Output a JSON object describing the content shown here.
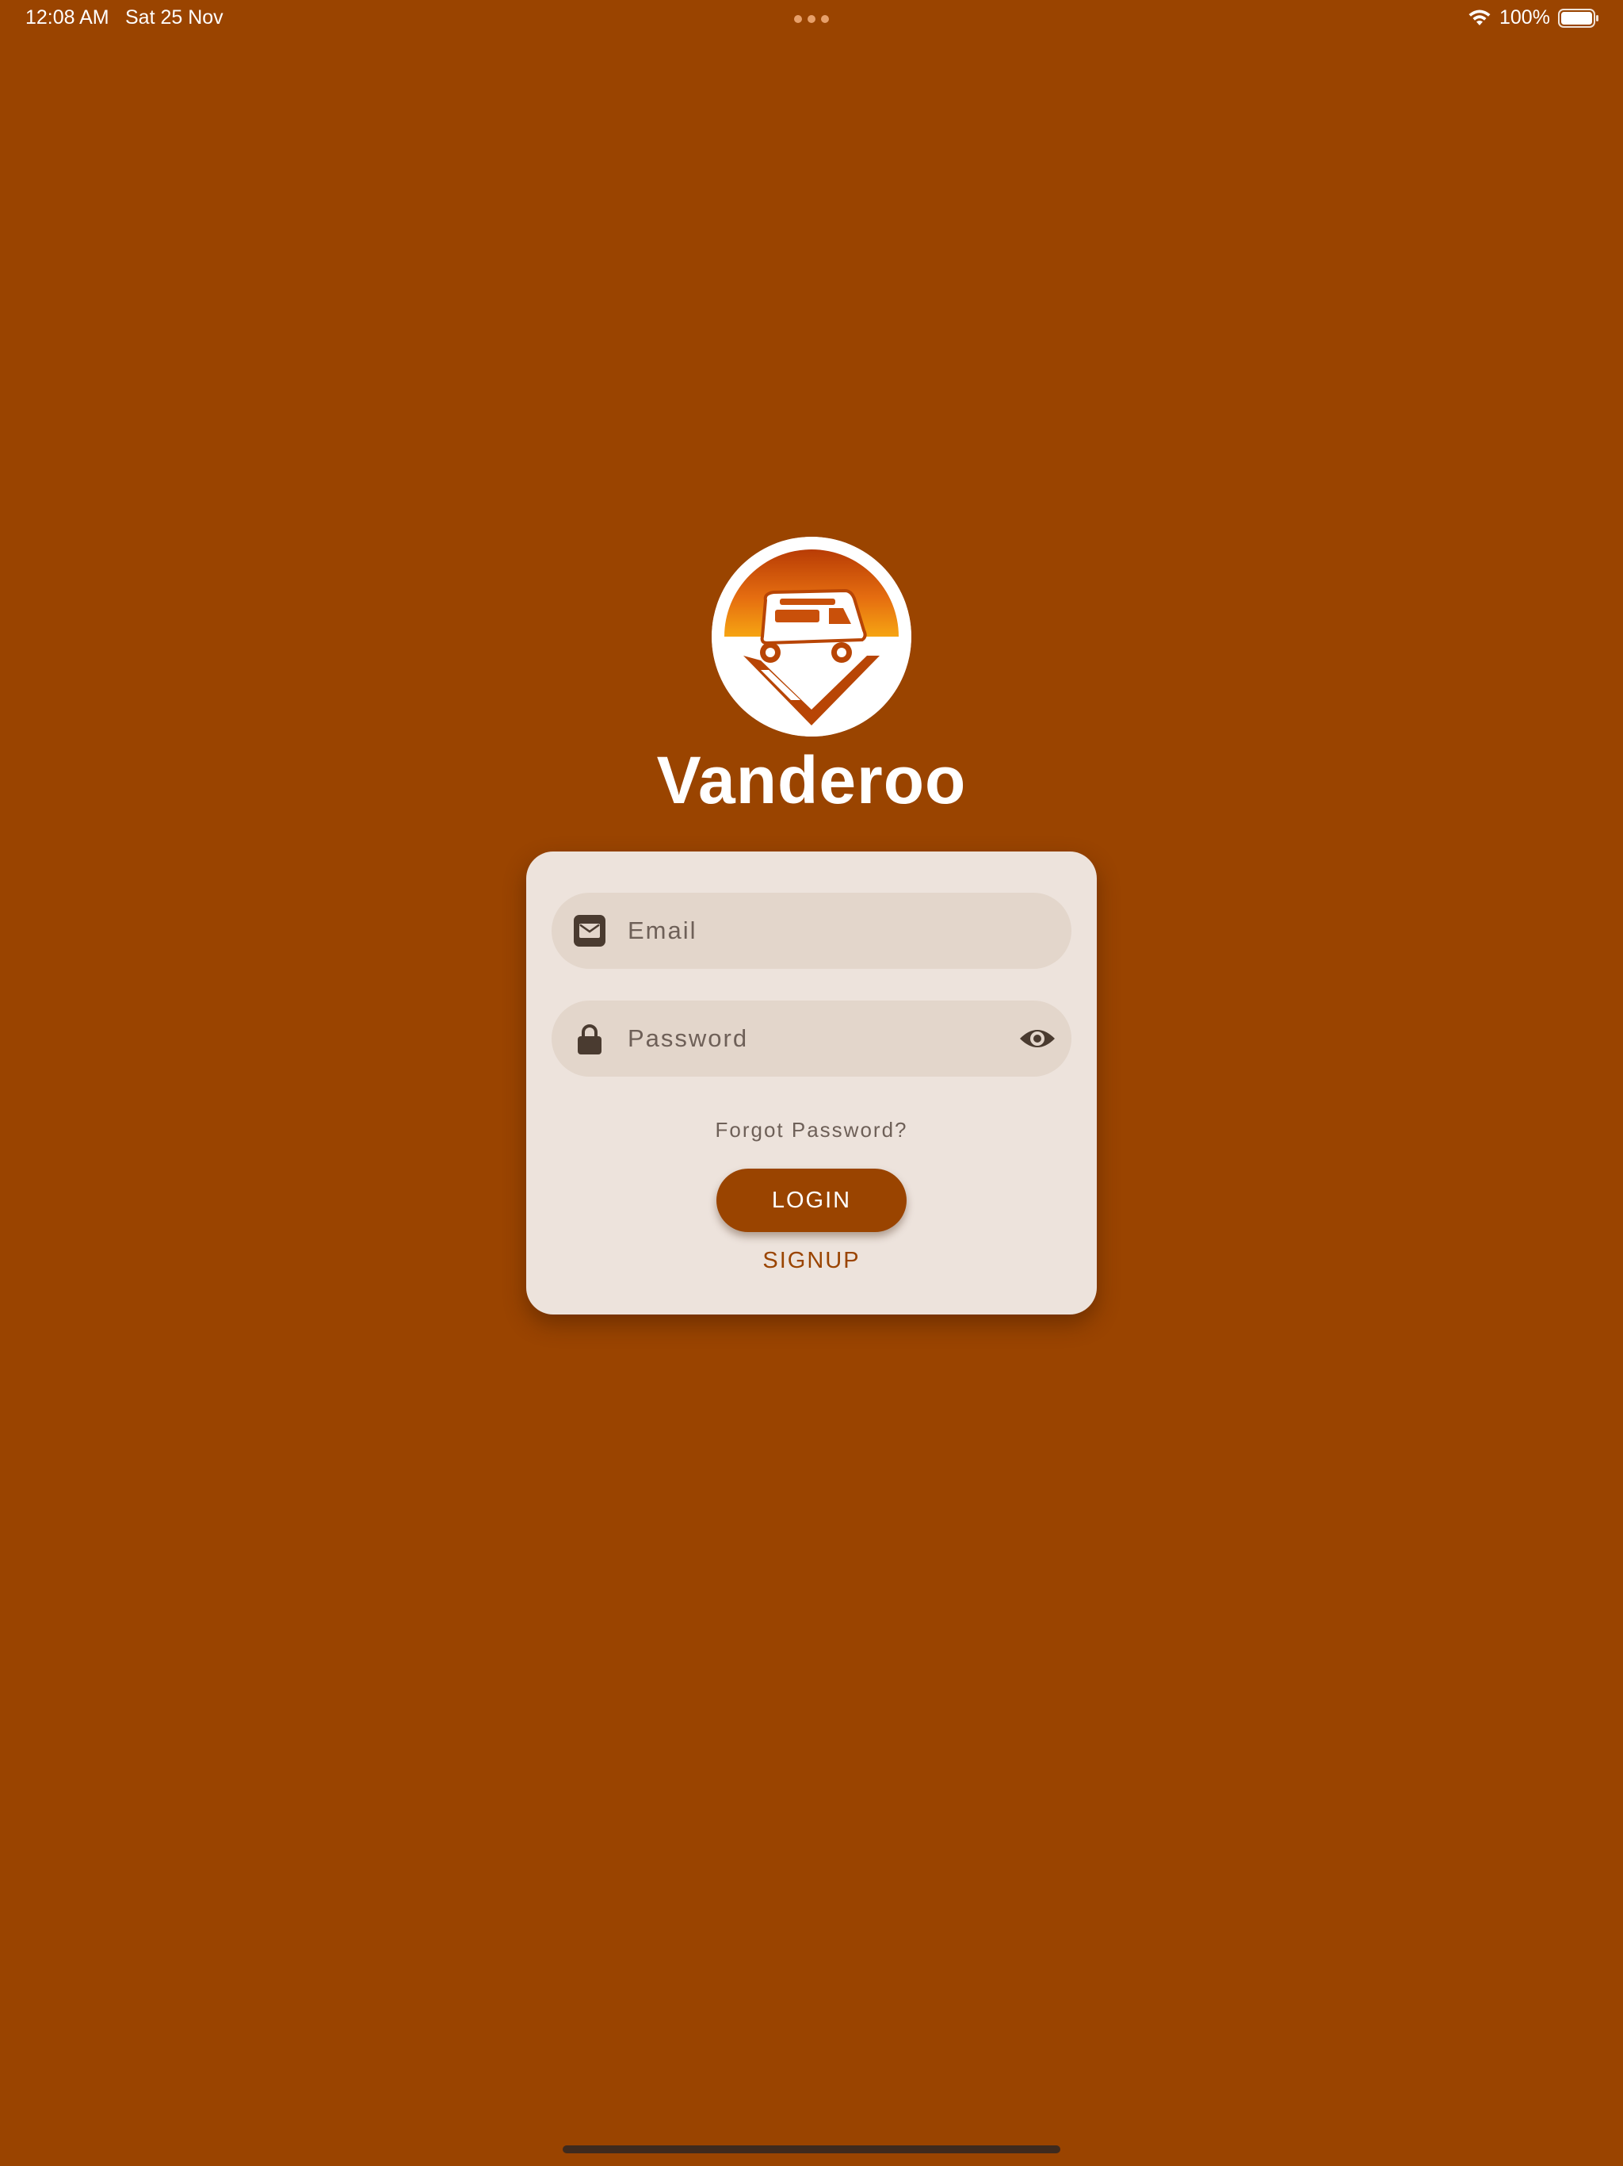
{
  "status_bar": {
    "time": "12:08 AM",
    "date": "Sat 25 Nov",
    "battery_percent": "100%",
    "icons": [
      "wifi-icon",
      "battery-icon",
      "multitask-dots"
    ]
  },
  "app": {
    "title": "Vanderoo",
    "logo_icon": "campervan-sunset-logo"
  },
  "login_form": {
    "email": {
      "placeholder": "Email",
      "value": "",
      "icon": "envelope-icon"
    },
    "password": {
      "placeholder": "Password",
      "value": "",
      "icon": "lock-icon",
      "toggle_icon": "eye-icon"
    },
    "forgot_password_label": "Forgot Password?",
    "login_label": "LOGIN",
    "signup_label": "SIGNUP"
  },
  "colors": {
    "background": "#9a4400",
    "card": "#ede3dc",
    "field": "#e3d6cb",
    "icon": "#4a3b30",
    "accent": "#9a4400"
  }
}
